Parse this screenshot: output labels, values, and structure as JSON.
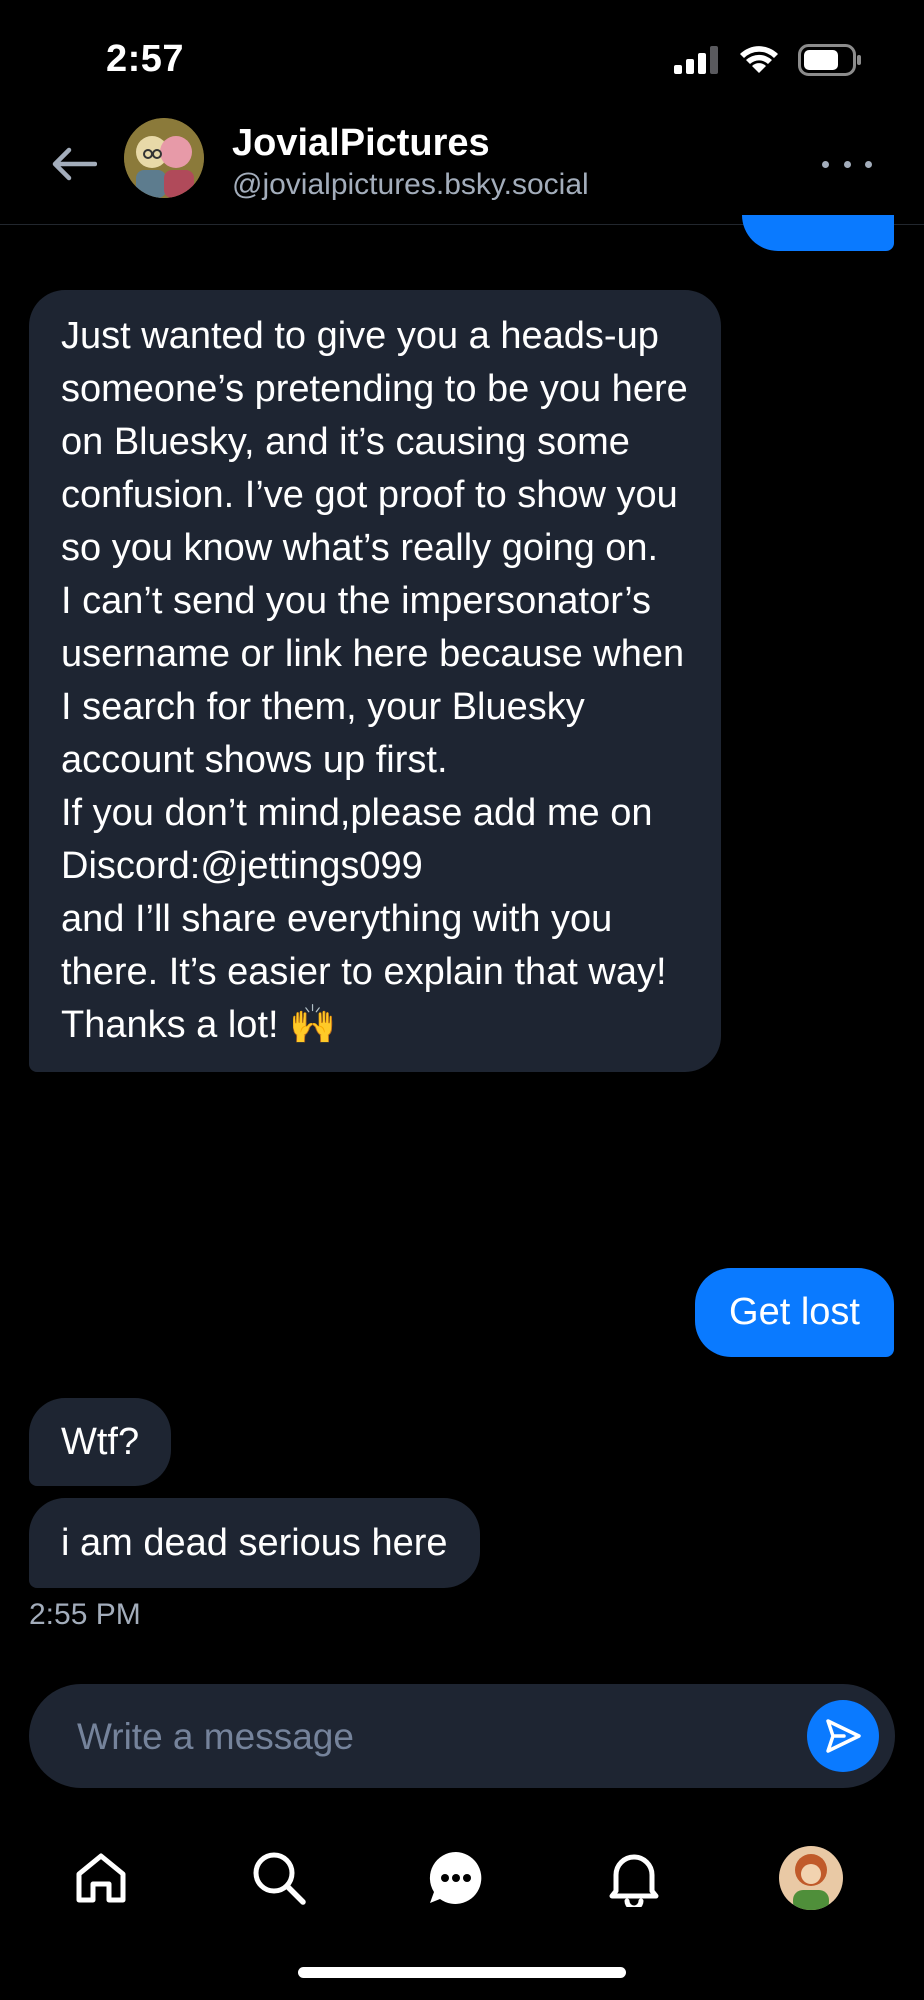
{
  "status_bar": {
    "time": "2:57"
  },
  "header": {
    "name": "JovialPictures",
    "handle": "@jovialpictures.bsky.social"
  },
  "messages": [
    {
      "direction": "incoming",
      "text": "Just wanted to give you a heads-up someone’s pretending to be you here on Bluesky, and it’s causing some confusion. I’ve got proof to show you so you know what’s really going on.\nI can’t send you the impersonator’s username or link here because when I search for them, your Bluesky account shows up first.\nIf you don’t mind,please add me on Discord:@jettings099\nand I’ll share everything with you there. It’s easier to explain that way!\nThanks a lot! 🙌"
    },
    {
      "direction": "outgoing",
      "text": "Get lost"
    },
    {
      "direction": "incoming",
      "text": "Wtf?"
    },
    {
      "direction": "incoming",
      "text": "i am dead serious here"
    }
  ],
  "last_timestamp": "2:55 PM",
  "composer": {
    "placeholder": "Write a message"
  },
  "tab_bar": {
    "items": [
      {
        "icon": "home-icon"
      },
      {
        "icon": "search-icon"
      },
      {
        "icon": "chat-icon"
      },
      {
        "icon": "bell-icon"
      },
      {
        "icon": "profile-avatar"
      }
    ]
  },
  "colors": {
    "background": "#000000",
    "incoming_bubble": "#1e2532",
    "outgoing_bubble": "#0a7aff",
    "secondary_text": "#a3adbb",
    "placeholder": "#75839b"
  }
}
